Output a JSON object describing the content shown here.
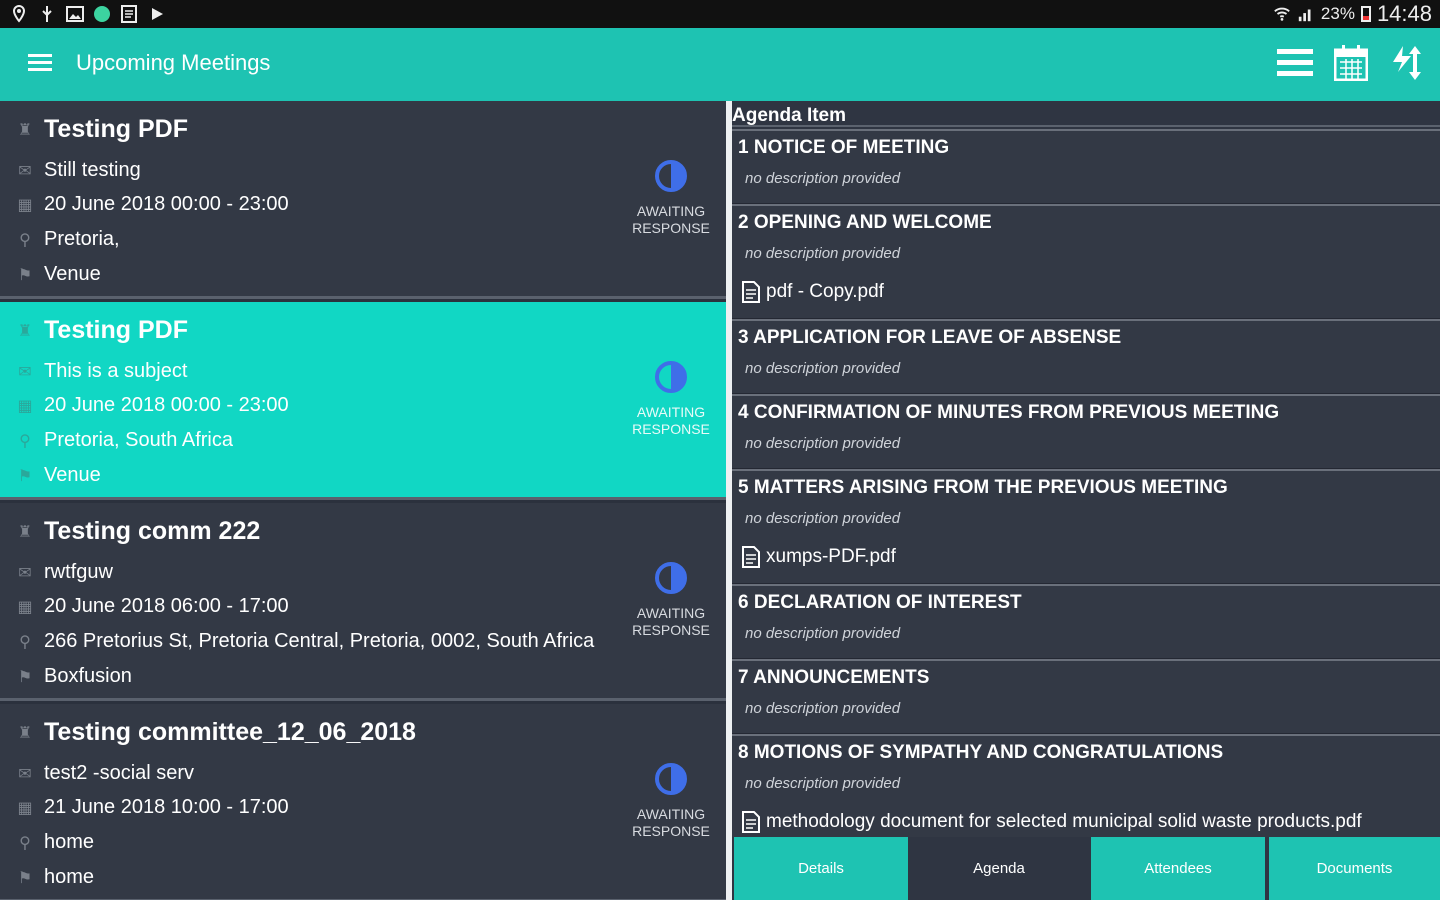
{
  "status_bar": {
    "left_icons": [
      "location-icon",
      "usb-icon",
      "image-icon",
      "app-dot-icon",
      "document-icon",
      "play-icon"
    ],
    "battery_pct": "23%",
    "time": "14:48"
  },
  "app_bar": {
    "title": "Upcoming Meetings",
    "actions": [
      "list-icon",
      "calendar-icon",
      "sync-icon"
    ],
    "accent_color": "#1ec3b2"
  },
  "meetings": [
    {
      "title": "Testing PDF",
      "subject": "Still testing",
      "date": "20 June 2018 00:00  -  23:00",
      "location": "Pretoria,",
      "venue": "Venue",
      "status_line1": "AWAITING",
      "status_line2": "RESPONSE",
      "selected": false
    },
    {
      "title": "Testing PDF",
      "subject": "This is  a subject",
      "date": "20 June 2018 00:00  -  23:00",
      "location": "Pretoria, South Africa",
      "venue": "Venue",
      "status_line1": "AWAITING",
      "status_line2": "RESPONSE",
      "selected": true
    },
    {
      "title": "Testing comm 222",
      "subject": "rwtfguw",
      "date": "20 June 2018 06:00  -  17:00",
      "location": "266 Pretorius St, Pretoria Central, Pretoria, 0002, South Africa",
      "venue": "Boxfusion",
      "status_line1": "AWAITING",
      "status_line2": "RESPONSE",
      "selected": false
    },
    {
      "title": "Testing committee_12_06_2018",
      "subject": "test2 -social serv",
      "date": "21 June 2018 10:00  -  17:00",
      "location": "home",
      "venue": "home",
      "status_line1": "AWAITING",
      "status_line2": "RESPONSE",
      "selected": false
    }
  ],
  "agenda": {
    "header": "Agenda Item",
    "items": [
      {
        "title": "1 NOTICE OF MEETING",
        "description": "no description provided",
        "file": ""
      },
      {
        "title": "2 OPENING AND WELCOME",
        "description": "no description provided",
        "file": "pdf - Copy.pdf"
      },
      {
        "title": "3 APPLICATION FOR LEAVE OF ABSENSE",
        "description": "no description provided",
        "file": ""
      },
      {
        "title": "4 CONFIRMATION OF MINUTES FROM PREVIOUS MEETING",
        "description": "no description provided",
        "file": ""
      },
      {
        "title": "5 MATTERS ARISING FROM THE PREVIOUS MEETING",
        "description": "no description provided",
        "file": "xumps-PDF.pdf"
      },
      {
        "title": "6 DECLARATION OF INTEREST",
        "description": "no description provided",
        "file": ""
      },
      {
        "title": "7 ANNOUNCEMENTS",
        "description": "no description provided",
        "file": ""
      },
      {
        "title": "8 MOTIONS OF SYMPATHY AND CONGRATULATIONS",
        "description": "no description provided",
        "file": "methodology document for selected municipal solid waste products.pdf"
      }
    ]
  },
  "tabs": [
    {
      "label": "Details",
      "active": false
    },
    {
      "label": "Agenda",
      "active": true
    },
    {
      "label": "Attendees",
      "active": false
    },
    {
      "label": "Documents",
      "active": false
    }
  ]
}
